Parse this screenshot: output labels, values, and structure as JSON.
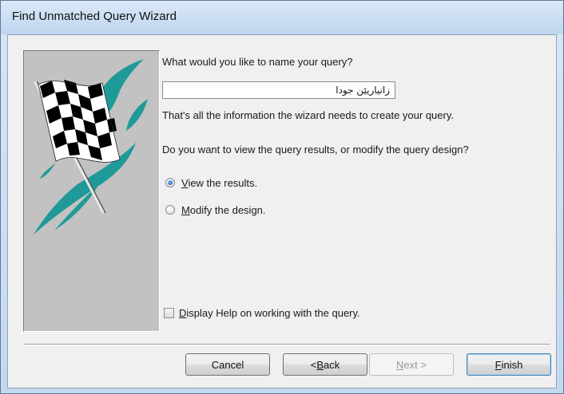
{
  "window": {
    "title": "Find Unmatched Query Wizard"
  },
  "picture": {
    "icon": "checkered-flag-icon"
  },
  "prompt": {
    "name_question": "What would you like to name your query?",
    "query_name_value": "زانیاریێن جودا",
    "info_text": "That's all the information the wizard needs to create your query.",
    "view_question": "Do you want to view the query results, or modify the query design?"
  },
  "options": [
    {
      "label_mnemonic": "V",
      "label_rest": "iew the results.",
      "selected": true
    },
    {
      "label_mnemonic": "M",
      "label_rest": "odify the design.",
      "selected": false
    }
  ],
  "help_checkbox": {
    "label_mnemonic": "D",
    "label_rest": "isplay Help on working with the query.",
    "checked": false
  },
  "buttons": {
    "cancel": "Cancel",
    "back_prefix": "< ",
    "back_mnemonic": "B",
    "back_rest": "ack",
    "next_mnemonic": "N",
    "next_rest": "ext >",
    "finish_mnemonic": "F",
    "finish_rest": "inish"
  },
  "colors": {
    "teal_swoosh": "#1f9a98",
    "flag_black": "#000000",
    "flag_white": "#ffffff",
    "panel_gray": "#c2c2c2"
  }
}
